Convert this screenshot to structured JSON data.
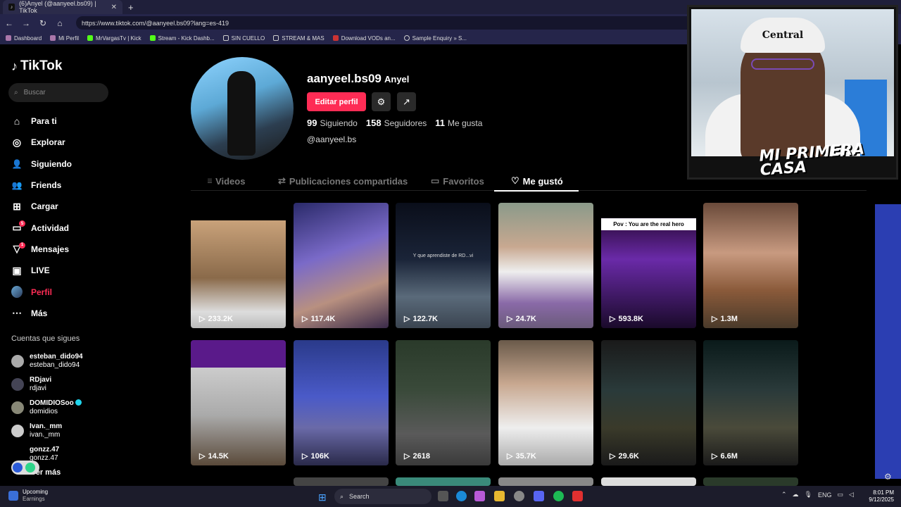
{
  "browser": {
    "tab_title": "(6)Anyel (@aanyeel.bs09) | TikTok",
    "tab_badge": "♪",
    "close": "✕",
    "new_tab": "+",
    "url": "https://www.tiktok.com/@aanyeel.bs09?lang=es-419",
    "nav": {
      "back": "←",
      "forward": "→",
      "reload": "↻",
      "home": "⌂"
    },
    "bookmarks": [
      "Dashboard",
      "Mi Perfil",
      "MrVargasTv | Kick",
      "Stream - Kick Dashb...",
      "SIN CUELLO",
      "STREAM & MAS",
      "Download VODs an...",
      "Sample Enquiry » S..."
    ]
  },
  "sidebar": {
    "logo": "TikTok",
    "logo_icon": "♪",
    "search_placeholder": "Buscar",
    "search_icon": "⌕",
    "nav": [
      {
        "label": "Para ti",
        "icon": "⌂"
      },
      {
        "label": "Explorar",
        "icon": "◎"
      },
      {
        "label": "Siguiendo",
        "icon": "👤"
      },
      {
        "label": "Friends",
        "icon": "👥"
      },
      {
        "label": "Cargar",
        "icon": "⊞"
      },
      {
        "label": "Actividad",
        "icon": "▭",
        "badge": "5"
      },
      {
        "label": "Mensajes",
        "icon": "▽",
        "badge": "1"
      },
      {
        "label": "LIVE",
        "icon": "▣"
      },
      {
        "label": "Perfil",
        "icon": ""
      },
      {
        "label": "Más",
        "icon": "⋯"
      }
    ],
    "following_title": "Cuentas que sigues",
    "following": [
      {
        "username": "esteban_dido94",
        "name": "esteban_dido94"
      },
      {
        "username": "RDjavi",
        "name": "rdjavi"
      },
      {
        "username": "DOMIDIOSoo",
        "name": "domidios",
        "verified": true
      },
      {
        "username": "Ivan._mm",
        "name": "ivan._mm"
      },
      {
        "username": "gonzz.47",
        "name": "gonzz.47"
      }
    ],
    "see_more": "Ver más"
  },
  "profile": {
    "username": "aanyeel.bs09",
    "nickname": "Anyel",
    "edit_button": "Editar perfil",
    "settings_icon": "⚙",
    "share_icon": "↗",
    "following_count": "99",
    "following_label": "Siguiendo",
    "followers_count": "158",
    "followers_label": "Seguidores",
    "likes_count": "11",
    "likes_label": "Me gusta",
    "handle": "@aanyeel.bs"
  },
  "tabs": [
    {
      "label": "Videos",
      "icon": "⦙⦙⦙"
    },
    {
      "label": "Publicaciones compartidas",
      "icon": "⇄"
    },
    {
      "label": "Favoritos",
      "icon": "▭"
    },
    {
      "label": "Me gustó",
      "icon": "♡",
      "active": true
    }
  ],
  "videos": [
    {
      "views": "233.2K",
      "caption": ""
    },
    {
      "views": "117.4K",
      "caption": ""
    },
    {
      "views": "122.7K",
      "caption": "Y que aprendiste de RD...vi"
    },
    {
      "views": "24.7K",
      "caption": ""
    },
    {
      "views": "593.8K",
      "caption": "Pov : You are the real hero"
    },
    {
      "views": "1.3M",
      "caption": ""
    },
    {
      "views": "14.5K",
      "caption": ""
    },
    {
      "views": "106K",
      "caption": ""
    },
    {
      "views": "2618",
      "caption": ""
    },
    {
      "views": "35.7K",
      "caption": ""
    },
    {
      "views": "29.6K",
      "caption": ""
    },
    {
      "views": "6.6M",
      "caption": ""
    }
  ],
  "play_icon": "▷",
  "stream_overlay": {
    "hat_text": "Central",
    "caption": "MI PRIMERA CASA"
  },
  "taskbar": {
    "weather_title": "Upcoming",
    "weather_sub": "Earnings",
    "search": "Search",
    "lang": "ENG",
    "time": "8:01 PM",
    "date": "9/12/2025"
  },
  "colors": {
    "accent": "#fe2c55",
    "background": "#000000",
    "verified": "#20d5ec"
  }
}
